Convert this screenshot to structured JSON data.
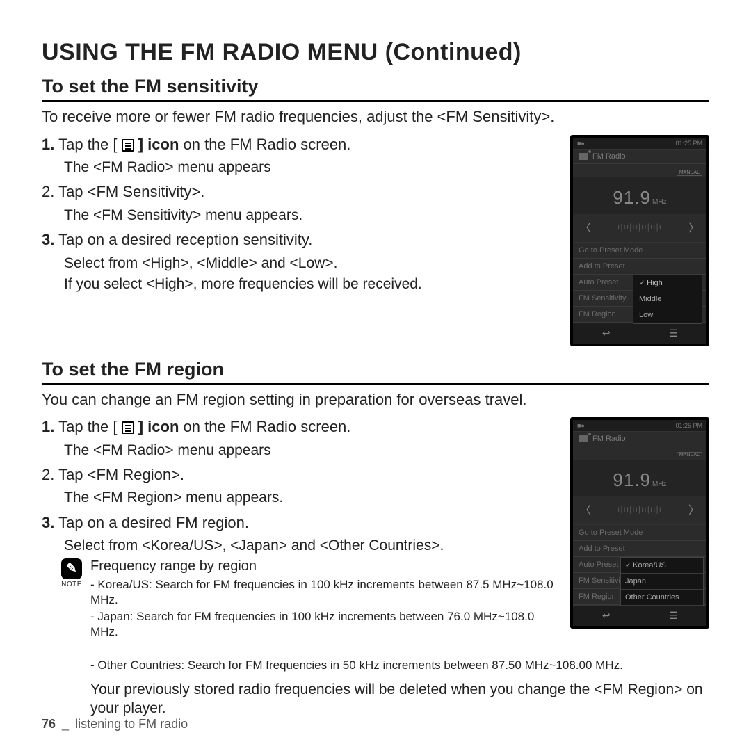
{
  "page_title": "USING THE FM RADIO MENU (Continued)",
  "sensitivity": {
    "title": "To set the FM sensitivity",
    "intro": "To receive more or fewer FM radio frequencies, adjust the <FM Sensitivity>.",
    "s1a": "1.",
    "s1b": "Tap the [",
    "s1c": "] icon",
    "s1d": " on the FM Radio screen.",
    "s1sub": "The <FM Radio> menu appears",
    "s2": "2.  Tap <FM Sensitivity>.",
    "s2sub": "The <FM Sensitivity> menu appears.",
    "s3a": "3.",
    "s3b": "Tap on a desired reception sensitivity.",
    "s3sub1": "Select from <High>, <Middle> and <Low>.",
    "s3sub2": "If you select <High>, more frequencies will be received."
  },
  "region": {
    "title": "To set the FM region",
    "intro": "You can change an FM region setting in preparation for overseas travel.",
    "s1a": "1.",
    "s1b": "Tap the [",
    "s1c": "] icon",
    "s1d": " on the FM Radio screen.",
    "s1sub": "The <FM Radio> menu appears",
    "s2": "2.  Tap <FM Region>.",
    "s2sub": "The <FM Region> menu appears.",
    "s3a": "3.",
    "s3b": "Tap on a desired FM region.",
    "s3sub": "Select from <Korea/US>, <Japan> and <Other Countries>.",
    "note_label": "NOTE",
    "note_title": "Frequency range by region",
    "note_l1": "- Korea/US: Search for FM frequencies in 100 kHz increments between 87.5 MHz~108.0 MHz.",
    "note_l2": "- Japan: Search for FM frequencies in 100 kHz increments between 76.0 MHz~108.0 MHz.",
    "note_l3": "- Other Countries: Search for FM frequencies in 50 kHz increments between 87.50 MHz~108.00 MHz.",
    "note_long": "Your previously stored radio frequencies will be deleted when you change the <FM Region> on your player."
  },
  "phone": {
    "time": "01:25 PM",
    "title": "FM Radio",
    "manual": "MANUAL",
    "freq": "91.9",
    "unit": "MHz",
    "m1": "Go to Preset Mode",
    "m2": "Add to Preset",
    "m3": "Auto Preset",
    "m4": "FM Sensitivity",
    "m5": "FM Region",
    "opt_high": "High",
    "opt_middle": "Middle",
    "opt_low": "Low",
    "opt_korea": "Korea/US",
    "opt_japan": "Japan",
    "opt_other": "Other Countries",
    "back": "↩",
    "menu": "☰"
  },
  "footer": {
    "page": "76",
    "sep": "_",
    "chapter": "listening to FM radio"
  }
}
